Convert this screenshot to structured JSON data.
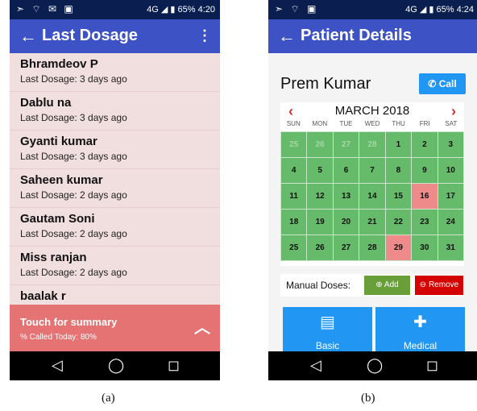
{
  "screens": [
    {
      "status_left": "➣ ⌔ ✉ ▣",
      "network": "4G",
      "battery": "65%",
      "time": "4:20",
      "title": "Last Dosage",
      "back_glyph": "←",
      "menu_glyph": "⋮",
      "patients": [
        {
          "name": "Bhramdeov P",
          "last": "Last Dosage: 3 days ago"
        },
        {
          "name": "Dablu  na",
          "last": "Last Dosage: 3 days ago"
        },
        {
          "name": "Gyanti kumar",
          "last": "Last Dosage: 3 days ago"
        },
        {
          "name": "Saheen kumar",
          "last": "Last Dosage: 2 days ago"
        },
        {
          "name": "Gautam Soni",
          "last": "Last Dosage: 2 days ago"
        },
        {
          "name": "Miss ranjan",
          "last": "Last Dosage: 2 days ago"
        },
        {
          "name": "baalak  r",
          "last": ""
        }
      ],
      "summary_title": "Touch for summary",
      "summary_sub": "% Called Today: 80%",
      "caption": "(a)"
    },
    {
      "status_left": "➣ ⌔ ▣",
      "network": "4G",
      "battery": "65%",
      "time": "4:24",
      "title": "Patient Details",
      "back_glyph": "←",
      "patient_name": "Prem Kumar",
      "call_label": "Call",
      "month": "MARCH 2018",
      "weekdays": [
        "SUN",
        "MON",
        "TUE",
        "WED",
        "THU",
        "FRI",
        "SAT"
      ],
      "days": [
        "25",
        "26",
        "27",
        "28",
        "1",
        "2",
        "3",
        "4",
        "5",
        "6",
        "7",
        "8",
        "9",
        "10",
        "11",
        "12",
        "13",
        "14",
        "15",
        "16",
        "17",
        "18",
        "19",
        "20",
        "21",
        "22",
        "23",
        "24",
        "25",
        "26",
        "27",
        "28",
        "29",
        "30",
        "31"
      ],
      "manual_label": "Manual Doses:",
      "add_label": "⊕ Add",
      "remove_label": "⊖ Remove",
      "tile_basic": "Basic",
      "tile_medical": "Medical",
      "caption": "(b)"
    }
  ],
  "nav": {
    "back": "◁",
    "home": "◯",
    "recent": "◻"
  },
  "colors": {
    "appbar": "#3d52c4",
    "statusbar": "#0a1f4f",
    "list_bg": "#f1dede",
    "summary": "#e57373",
    "calendar_taken": "#66bb6a",
    "calendar_missed": "#ef8a8a",
    "call": "#2196f3",
    "add": "#689f38",
    "remove": "#d50000"
  }
}
